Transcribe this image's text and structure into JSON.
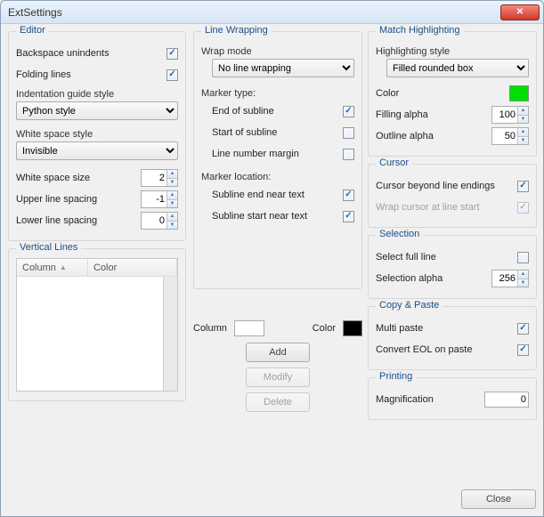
{
  "window": {
    "title": "ExtSettings"
  },
  "editor": {
    "title": "Editor",
    "backspace_unindents": {
      "label": "Backspace unindents",
      "checked": true
    },
    "folding_lines": {
      "label": "Folding lines",
      "checked": true
    },
    "indent_guide_label": "Indentation guide style",
    "indent_guide_value": "Python style",
    "whitespace_style_label": "White space style",
    "whitespace_style_value": "Invisible",
    "whitespace_size": {
      "label": "White space size",
      "value": "2"
    },
    "upper_spacing": {
      "label": "Upper line spacing",
      "value": "-1"
    },
    "lower_spacing": {
      "label": "Lower line spacing",
      "value": "0"
    }
  },
  "vlines": {
    "title": "Vertical Lines",
    "col_column": "Column",
    "col_color": "Color",
    "column_label": "Column",
    "column_value": "",
    "color_label": "Color",
    "color_value": "#000000",
    "btn_add": "Add",
    "btn_modify": "Modify",
    "btn_delete": "Delete"
  },
  "wrap": {
    "title": "Line Wrapping",
    "mode_label": "Wrap mode",
    "mode_value": "No line wrapping",
    "marker_type_label": "Marker type:",
    "end_subline": {
      "label": "End of subline",
      "checked": true
    },
    "start_subline": {
      "label": "Start of subline",
      "checked": false
    },
    "linenum_margin": {
      "label": "Line number margin",
      "checked": false
    },
    "marker_loc_label": "Marker location:",
    "subline_end_near": {
      "label": "Subline end near text",
      "checked": true
    },
    "subline_start_near": {
      "label": "Subline start near text",
      "checked": true
    }
  },
  "match": {
    "title": "Match Highlighting",
    "style_label": "Highlighting style",
    "style_value": "Filled rounded box",
    "color_label": "Color",
    "color_value": "#00e000",
    "filling_alpha": {
      "label": "Filling alpha",
      "value": "100"
    },
    "outline_alpha": {
      "label": "Outline alpha",
      "value": "50"
    }
  },
  "cursor": {
    "title": "Cursor",
    "beyond": {
      "label": "Cursor beyond line endings",
      "checked": true
    },
    "wrap_start": {
      "label": "Wrap cursor at line start",
      "checked": true,
      "disabled": true
    }
  },
  "selection": {
    "title": "Selection",
    "full_line": {
      "label": "Select full line",
      "checked": false
    },
    "alpha": {
      "label": "Selection alpha",
      "value": "256"
    }
  },
  "copy": {
    "title": "Copy & Paste",
    "multi_paste": {
      "label": "Multi paste",
      "checked": true
    },
    "convert_eol": {
      "label": "Convert EOL on paste",
      "checked": true
    }
  },
  "printing": {
    "title": "Printing",
    "magnification": {
      "label": "Magnification",
      "value": "0"
    }
  },
  "footer": {
    "close": "Close"
  }
}
